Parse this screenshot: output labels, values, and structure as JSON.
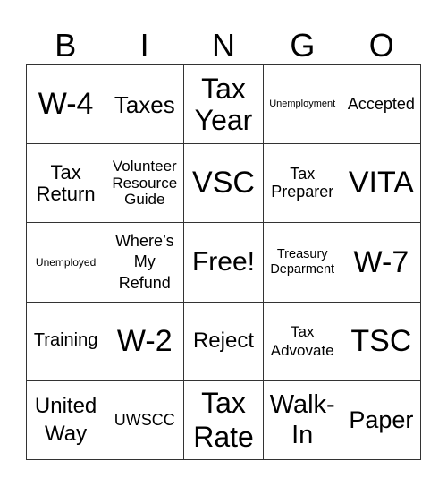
{
  "header": [
    "B",
    "I",
    "N",
    "G",
    "O"
  ],
  "cells": [
    [
      "W-4",
      "Taxes",
      "Tax Year",
      "Unemployment",
      "Accepted"
    ],
    [
      "Tax Return",
      "Volunteer Resource Guide",
      "VSC",
      "Tax Preparer",
      "VITA"
    ],
    [
      "Unemployed",
      "Where’s My Refund",
      "Free!",
      "Treasury Deparment",
      "W-7"
    ],
    [
      "Training",
      "W-2",
      "Reject",
      "Tax Advovate",
      "TSC"
    ],
    [
      "United Way",
      "UWSCC",
      "Tax Rate",
      "Walk-In",
      "Paper"
    ]
  ]
}
